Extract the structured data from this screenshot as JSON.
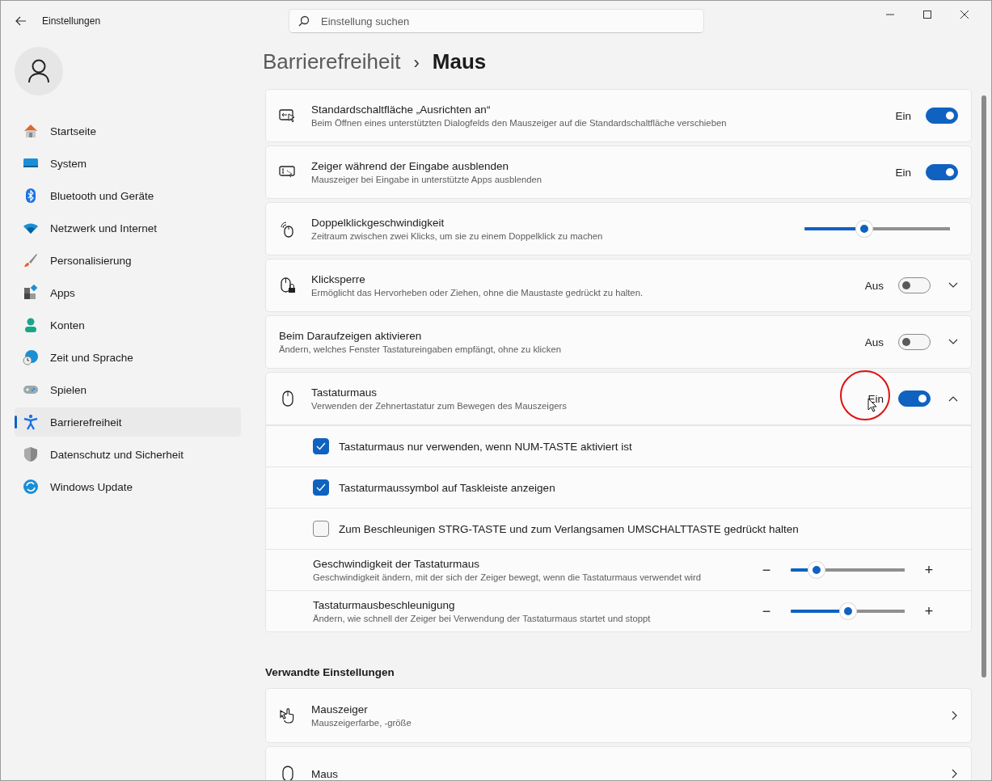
{
  "window": {
    "title": "Einstellungen",
    "search_placeholder": "Einstellung suchen"
  },
  "sidebar": {
    "items": [
      {
        "label": "Startseite",
        "selected": false
      },
      {
        "label": "System",
        "selected": false
      },
      {
        "label": "Bluetooth und Geräte",
        "selected": false
      },
      {
        "label": "Netzwerk und Internet",
        "selected": false
      },
      {
        "label": "Personalisierung",
        "selected": false
      },
      {
        "label": "Apps",
        "selected": false
      },
      {
        "label": "Konten",
        "selected": false
      },
      {
        "label": "Zeit und Sprache",
        "selected": false
      },
      {
        "label": "Spielen",
        "selected": false
      },
      {
        "label": "Barrierefreiheit",
        "selected": true
      },
      {
        "label": "Datenschutz und Sicherheit",
        "selected": false
      },
      {
        "label": "Windows Update",
        "selected": false
      }
    ]
  },
  "breadcrumb": {
    "parent": "Barrierefreiheit",
    "separator": "›",
    "current": "Maus"
  },
  "settings": [
    {
      "kind": "toggle",
      "title": "Standardschaltfläche „Ausrichten an“",
      "description": "Beim Öffnen eines unterstützten Dialogfelds den Mauszeiger auf die Standardschaltfläche verschieben",
      "state_label": "Ein",
      "on": true
    },
    {
      "kind": "toggle",
      "title": "Zeiger während der Eingabe ausblenden",
      "description": "Mauszeiger bei Eingabe in unterstützte Apps ausblenden",
      "state_label": "Ein",
      "on": true
    },
    {
      "kind": "slider",
      "title": "Doppelklickgeschwindigkeit",
      "description": "Zeitraum zwischen zwei Klicks, um sie zu einem Doppelklick zu machen",
      "level": 0.41
    },
    {
      "kind": "toggle",
      "title": "Klicksperre",
      "description": "Ermöglicht das Hervorheben oder Ziehen, ohne die Maustaste gedrückt zu halten.",
      "state_label": "Aus",
      "on": false,
      "expanded": false
    },
    {
      "kind": "toggle",
      "title": "Beim Daraufzeigen aktivieren",
      "description": "Ändern, welches Fenster Tastatureingaben empfängt, ohne zu klicken",
      "state_label": "Aus",
      "on": false,
      "expanded": false
    },
    {
      "kind": "toggle",
      "title": "Tastaturmaus",
      "description": "Verwenden der Zehnertastatur zum Bewegen des Mauszeigers",
      "state_label": "Ein",
      "on": true,
      "expanded": true,
      "highlighted": true,
      "children": [
        {
          "kind": "checkbox",
          "label": "Tastaturmaus nur verwenden, wenn NUM-TASTE aktiviert ist",
          "checked": true
        },
        {
          "kind": "checkbox",
          "label": "Tastaturmaussymbol auf Taskleiste anzeigen",
          "checked": true
        },
        {
          "kind": "checkbox",
          "label": "Zum Beschleunigen STRG-TASTE und zum Verlangsamen UMSCHALTTASTE gedrückt halten",
          "checked": false
        },
        {
          "kind": "slider",
          "title": "Geschwindigkeit der Tastaturmaus",
          "description": "Geschwindigkeit ändern, mit der sich der Zeiger bewegt, wenn die Tastaturmaus verwendet wird",
          "level": 0.23,
          "minus": "−",
          "plus": "+"
        },
        {
          "kind": "slider",
          "title": "Tastaturmausbeschleunigung",
          "description": "Ändern, wie schnell der Zeiger bei Verwendung der Tastaturmaus startet und stoppt",
          "level": 0.5,
          "minus": "−",
          "plus": "+"
        }
      ]
    }
  ],
  "related": {
    "heading": "Verwandte Einstellungen",
    "items": [
      {
        "title": "Mauszeiger",
        "description": "Mauszeigerfarbe, -größe"
      },
      {
        "title": "Maus"
      }
    ]
  }
}
